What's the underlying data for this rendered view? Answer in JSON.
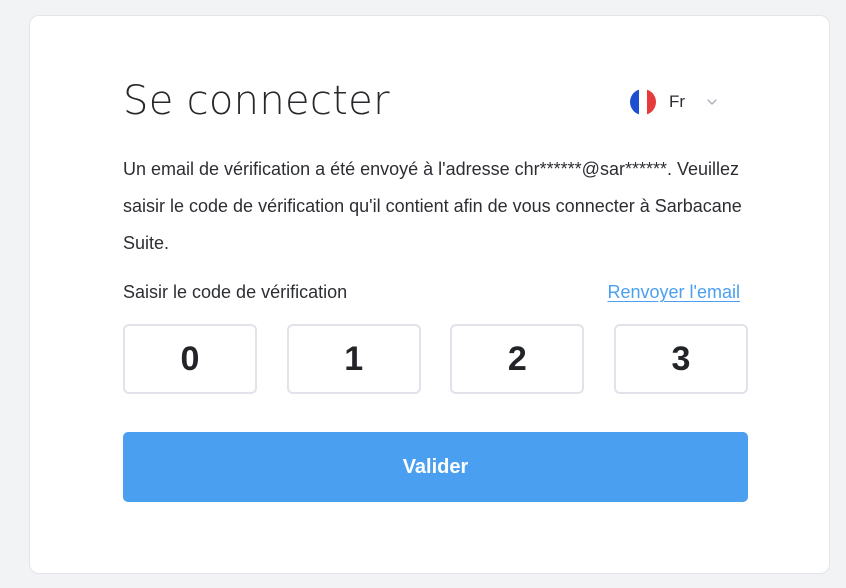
{
  "login": {
    "title": "Se connecter",
    "language": {
      "label": "Fr",
      "flag_icon": "france-flag-icon",
      "dropdown_icon": "chevron-down-icon"
    },
    "description": "Un email de vérification a été envoyé à l'adresse chr******@sar******. Veuillez saisir le code de vérification qu'il contient afin de vous connecter à Sarbacane Suite.",
    "code_label": "Saisir le code de vérification",
    "resend_link": "Renvoyer l'email",
    "code_digits": [
      "0",
      "1",
      "2",
      "3"
    ],
    "submit_label": "Valider"
  },
  "colors": {
    "accent": "#4a9ff0",
    "text": "#2c2e33",
    "background": "#f2f3f5",
    "card": "#ffffff",
    "input_border": "#e1e2ea"
  }
}
